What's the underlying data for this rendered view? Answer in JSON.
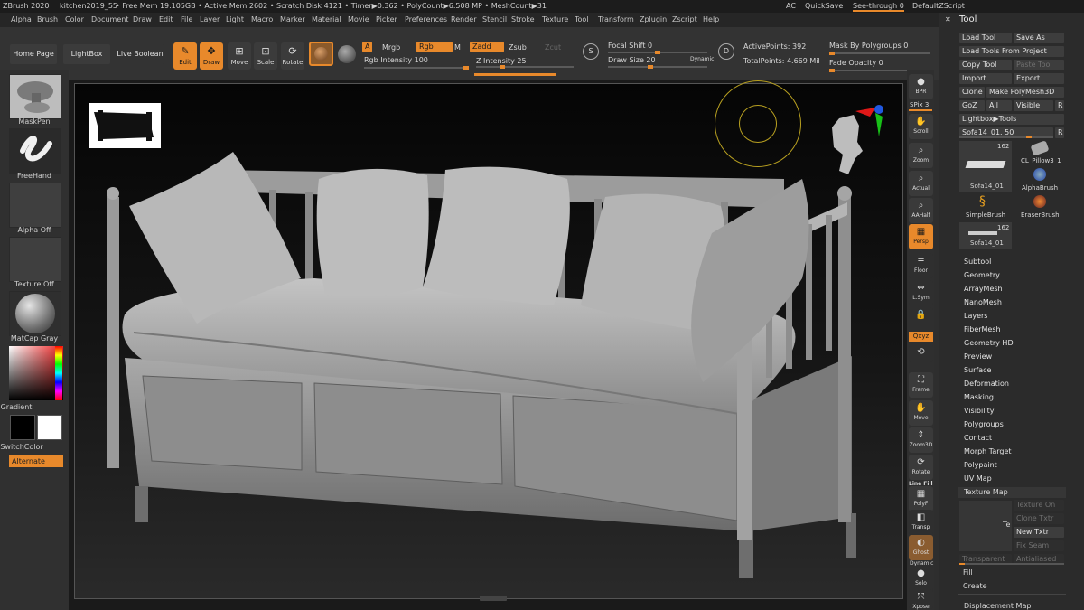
{
  "titlebar": {
    "app": "ZBrush 2020",
    "project": "kitchen2019_55",
    "stats": "• Free Mem 19.105GB • Active Mem 2602 • Scratch Disk 4121 • Timer▶0.362 • PolyCount▶6.508 MP • MeshCount▶31",
    "ac": "AC",
    "quicksave": "QuickSave",
    "seethrough": "See-through 0",
    "script": "DefaultZScript"
  },
  "menu": [
    "Alpha",
    "Brush",
    "Color",
    "Document",
    "Draw",
    "Edit",
    "File",
    "Layer",
    "Light",
    "Macro",
    "Marker",
    "Material",
    "Movie",
    "Picker",
    "Preferences",
    "Render",
    "Stencil",
    "Stroke",
    "Texture",
    "Tool",
    "Transform",
    "Zplugin",
    "Zscript",
    "Help"
  ],
  "shelf": {
    "home": "Home Page",
    "lightbox": "LightBox",
    "liveboolean": "Live Boolean",
    "edit": "Edit",
    "draw": "Draw",
    "move": "Move",
    "scale": "Scale",
    "rotate": "Rotate",
    "a": "A",
    "mrgb": "Mrgb",
    "rgb": "Rgb",
    "m": "M",
    "zadd": "Zadd",
    "zsub": "Zsub",
    "zcut": "Zcut",
    "rgb_intensity": "Rgb Intensity 100",
    "z_intensity": "Z Intensity 25",
    "z_intensity_value": 0.25,
    "focal_shift": "Focal Shift 0",
    "draw_size": "Draw Size 20",
    "dynamic": "Dynamic",
    "s": "S",
    "d": "D",
    "active_points": "ActivePoints: 392",
    "total_points": "TotalPoints: 4.669 Mil",
    "mask_by_polygroups": "Mask By Polygroups 0",
    "fade_opacity": "Fade Opacity 0"
  },
  "left": {
    "brush": "MaskPen",
    "stroke": "FreeHand",
    "alpha": "Alpha Off",
    "texture": "Texture Off",
    "material": "MatCap Gray",
    "gradient": "Gradient",
    "switchcolor": "SwitchColor",
    "alternate": "Alternate"
  },
  "right_shelf": {
    "bpr": "BPR",
    "spix": "SPix 3",
    "scroll": "Scroll",
    "zoom": "Zoom",
    "actual": "Actual",
    "aahalf": "AAHalf",
    "persp": "Persp",
    "floor": "Floor",
    "lsym": "L.Sym",
    "xyz": "Qxyz",
    "frame": "Frame",
    "move": "Move",
    "zoom3d": "Zoom3D",
    "rotate": "Rotate",
    "linefill": "Line Fill",
    "polyf": "PolyF",
    "transp": "Transp",
    "ghost": "Ghost",
    "dynamic": "Dynamic",
    "solo": "Solo",
    "xpose": "Xpose"
  },
  "tool": {
    "title": "Tool",
    "buttons": [
      "Load Tool",
      "Save As",
      "Load Tools From Project",
      "Copy Tool",
      "Paste Tool",
      "Import",
      "Export",
      "Clone",
      "Make PolyMesh3D",
      "GoZ",
      "All",
      "Visible",
      "R"
    ],
    "lightbox_tools": "Lightbox▶Tools",
    "current_tool": "Sofa14_01. 50",
    "r": "R",
    "thumbs": {
      "count1": "162",
      "sofa": "Sofa14_01",
      "pillow": "CL_Pillow3_1",
      "alphabrush": "AlphaBrush",
      "simplebrush": "SimpleBrush",
      "eraserbrush": "EraserBrush",
      "count2": "162",
      "sofa2": "Sofa14_01"
    },
    "subpalettes": [
      "Subtool",
      "Geometry",
      "ArrayMesh",
      "NanoMesh",
      "Layers",
      "FiberMesh",
      "Geometry HD",
      "Preview",
      "Surface",
      "Deformation",
      "Masking",
      "Visibility",
      "Polygroups",
      "Contact",
      "Morph Target",
      "Polypaint",
      "UV Map"
    ],
    "texture_map": {
      "title": "Texture Map",
      "preview": "Te",
      "texture_on": "Texture On",
      "clone_txtr": "Clone Txtr",
      "new_txtr": "New Txtr",
      "fix_seam": "Fix Seam",
      "transparent": "Transparent",
      "antialiased": "Antialiased"
    },
    "fill": "Fill",
    "create": "Create",
    "displacement": "Displacement Map"
  }
}
